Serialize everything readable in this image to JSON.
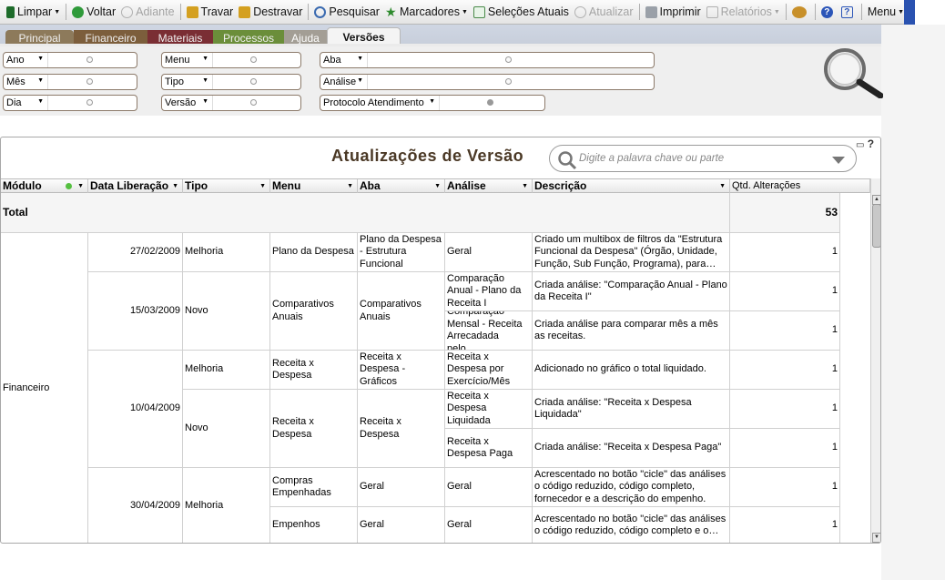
{
  "toolbar": {
    "items": [
      {
        "label": "Limpar",
        "icon": "clear-icon",
        "dropdown": true,
        "enabled": true
      },
      {
        "label": "Voltar",
        "icon": "back-icon",
        "enabled": true
      },
      {
        "label": "Adiante",
        "icon": "forward-icon",
        "enabled": false
      },
      {
        "label": "Travar",
        "icon": "lock-icon",
        "enabled": true
      },
      {
        "label": "Destravar",
        "icon": "unlock-icon",
        "enabled": true
      },
      {
        "label": "Pesquisar",
        "icon": "search-icon",
        "enabled": true
      },
      {
        "label": "Marcadores",
        "icon": "bookmark-icon",
        "dropdown": true,
        "enabled": true
      },
      {
        "label": "Seleções Atuais",
        "icon": "checklist-icon",
        "enabled": true
      },
      {
        "label": "Atualizar",
        "icon": "refresh-icon",
        "enabled": false
      },
      {
        "label": "Imprimir",
        "icon": "print-icon",
        "enabled": true
      },
      {
        "label": "Relatórios",
        "icon": "reports-icon",
        "dropdown": true,
        "enabled": false
      }
    ],
    "menu_label": "Menu"
  },
  "tabs": [
    {
      "label": "Principal",
      "color": "#8d7a5b"
    },
    {
      "label": "Financeiro",
      "color": "#7c5e3c"
    },
    {
      "label": "Materiais",
      "color": "#7a2e34"
    },
    {
      "label": "Processos",
      "color": "#6b8e3a"
    },
    {
      "label": "Ajuda",
      "color": "#a39e95"
    },
    {
      "label": "Versões",
      "color": "#ffffff",
      "active": true
    }
  ],
  "filters": [
    {
      "label": "Ano"
    },
    {
      "label": "Mês"
    },
    {
      "label": "Dia"
    },
    {
      "label": "Menu"
    },
    {
      "label": "Tipo"
    },
    {
      "label": "Versão"
    },
    {
      "label": "Aba"
    },
    {
      "label": "Análise"
    },
    {
      "label": "Protocolo Atendimento"
    }
  ],
  "panel": {
    "title": "Atualizações de Versão",
    "search_placeholder": "Digite a palavra chave ou parte",
    "columns": [
      "Módulo",
      "Data Liberação",
      "Tipo",
      "Menu",
      "Aba",
      "Análise",
      "Descrição",
      "Qtd. Alterações"
    ],
    "total_label": "Total",
    "total_value": "53",
    "module": "Financeiro",
    "dates": [
      "27/02/2009",
      "15/03/2009",
      "10/04/2009",
      "30/04/2009"
    ],
    "types": [
      "Melhoria",
      "Novo",
      "Melhoria",
      "Novo",
      "Melhoria"
    ],
    "menus": [
      "Plano da Despesa",
      "Comparativos Anuais",
      "Receita x Despesa",
      "Receita x Despesa",
      "Compras Empenhadas",
      "Empenhos"
    ],
    "abas": [
      "Plano da Despesa - Estrutura Funcional",
      "Comparativos Anuais",
      "Receita x Despesa - Gráficos",
      "Receita x Despesa",
      "Geral",
      "Geral"
    ],
    "rows": [
      {
        "analise": "Geral",
        "descricao": "Criado um multibox de filtros da \"Estrutura Funcional da Despesa\" (Órgão, Unidade, Função, Sub Função, Programa),  para…",
        "qtd": "1"
      },
      {
        "analise": "Comparação Anual - Plano da Receita I",
        "descricao": "Criada análise: \"Comparação Anual - Plano da Receita I\"",
        "qtd": "1"
      },
      {
        "analise": "Comparação Mensal - Receita Arrecadada pelo…",
        "descricao": "Criada análise para comparar mês a mês as receitas.",
        "qtd": "1"
      },
      {
        "analise": "Receita x Despesa por Exercício/Mês",
        "descricao": "Adicionado no gráfico o total liquidado.",
        "qtd": "1"
      },
      {
        "analise": "Receita x Despesa Liquidada",
        "descricao": "Criada análise: \"Receita x Despesa Liquidada\"",
        "qtd": "1"
      },
      {
        "analise": "Receita x Despesa Paga",
        "descricao": "Criada análise: \"Receita x Despesa Paga\"",
        "qtd": "1"
      },
      {
        "analise": "Geral",
        "descricao": "Acrescentado no botão \"cicle\" das análises o código reduzido, código completo, fornecedor e a descrição do empenho.",
        "qtd": "1"
      },
      {
        "analise": "Geral",
        "descricao": "Acrescentado no botão \"cicle\" das análises o código reduzido, código completo e o…",
        "qtd": "1"
      }
    ]
  }
}
